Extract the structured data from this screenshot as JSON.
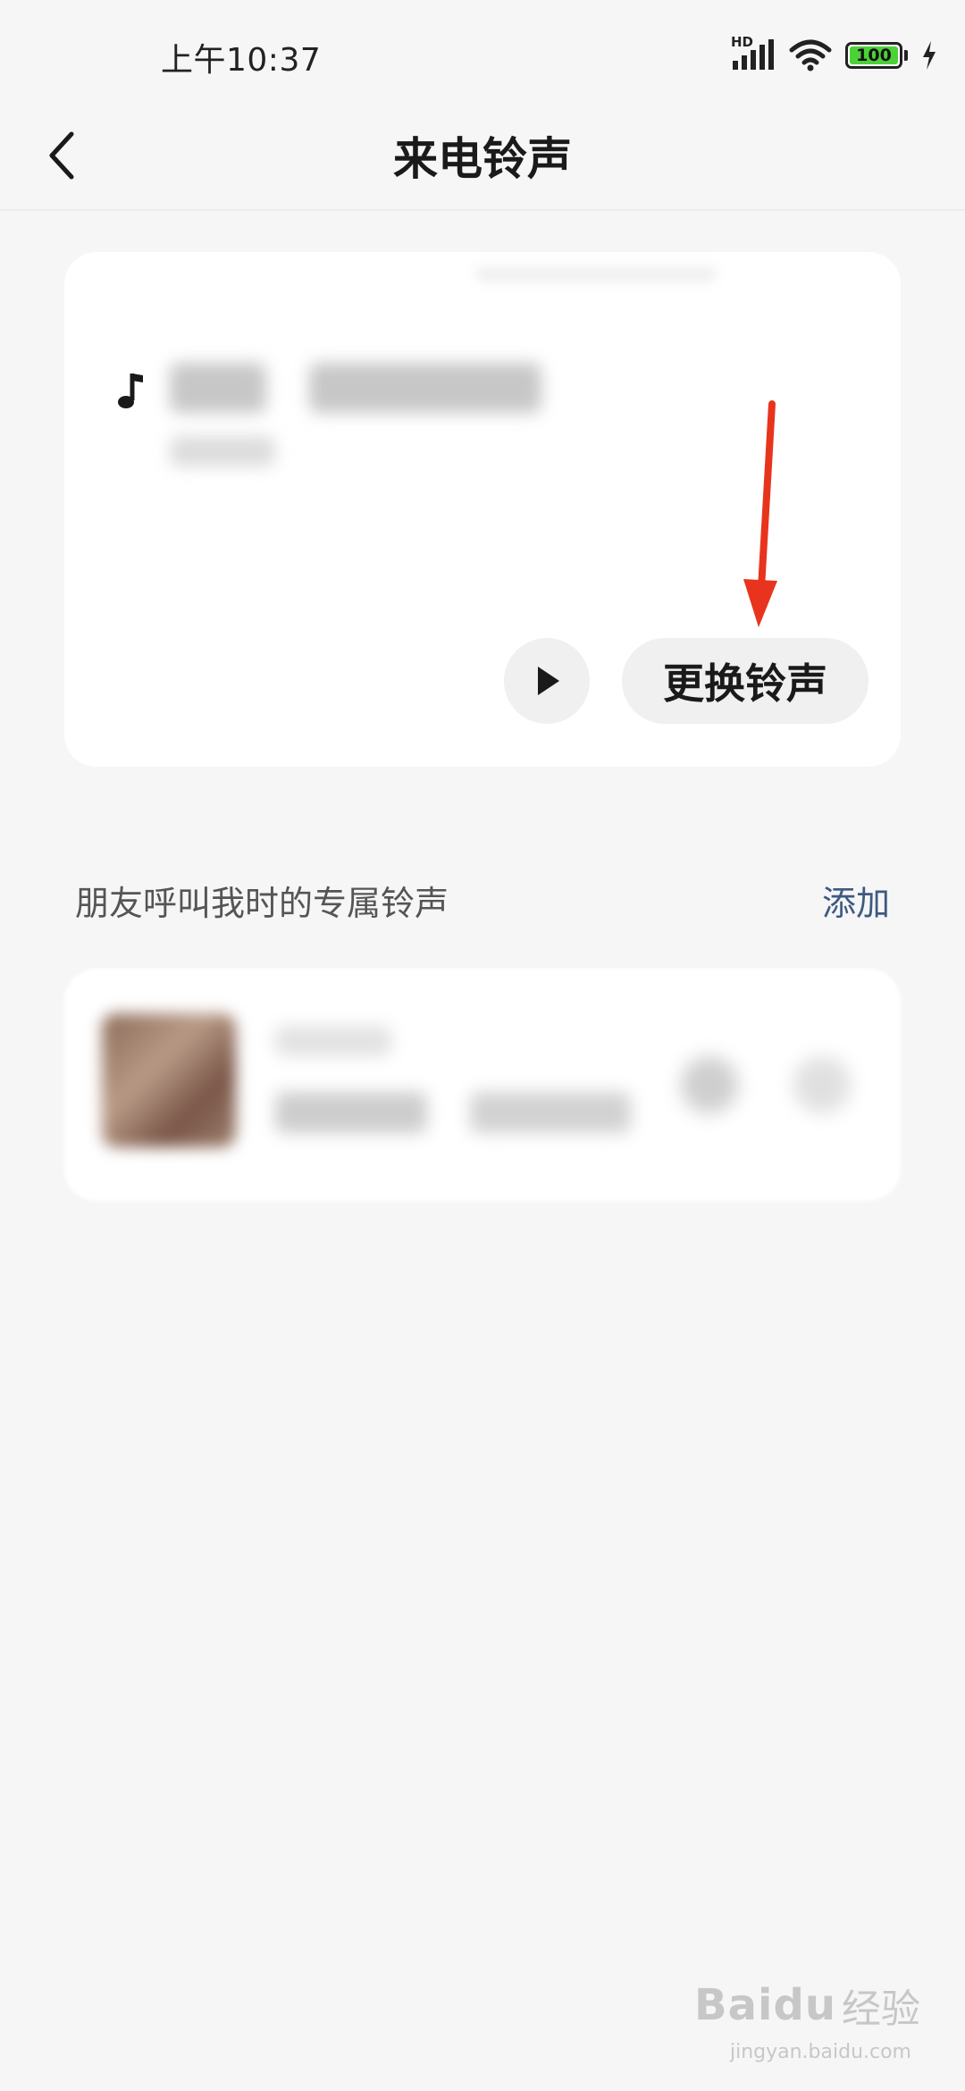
{
  "status_bar": {
    "time": "上午10:37",
    "network_label": "HD",
    "battery_level": 100,
    "battery_label": "100",
    "battery_color": "#4cd137",
    "icons": [
      "signal-icon",
      "wifi-icon",
      "battery-icon",
      "charging-icon"
    ]
  },
  "header": {
    "back_icon": "chevron-left-icon",
    "title": "来电铃声"
  },
  "ringtone_card": {
    "icon": "music-note-icon",
    "play_icon": "play-icon",
    "change_label": "更换铃声"
  },
  "friends_section": {
    "title": "朋友呼叫我时的专属铃声",
    "add_label": "添加",
    "add_color": "#3e5a80"
  },
  "annotation": {
    "arrow_color": "#e8341c"
  },
  "watermark": {
    "brand": "Baidu",
    "suffix": "经验",
    "url": "jingyan.baidu.com"
  }
}
